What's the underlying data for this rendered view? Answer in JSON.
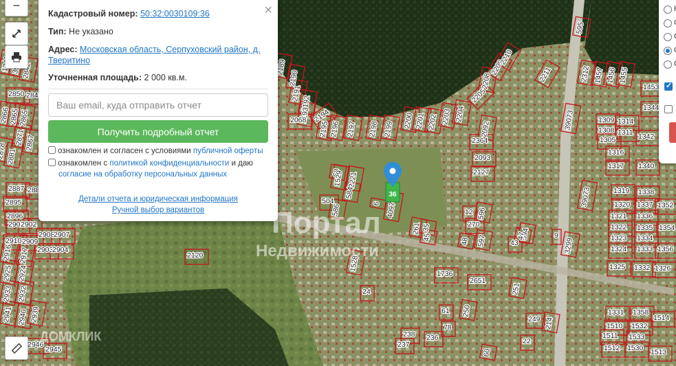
{
  "map": {
    "controls": {
      "zoom_out_label": "−",
      "fullscreen_icon": "expand-icon",
      "print_icon": "printer-icon",
      "ruler_icon": "ruler-icon"
    },
    "labels": [
      "2840",
      "2841",
      "2842",
      "2850",
      "2849",
      "2866",
      "2865",
      "2865",
      "2871",
      "2878",
      "2867",
      "2881",
      "2895",
      "2887",
      "2896",
      "2889",
      "2901",
      "2902",
      "2910",
      "2909",
      "2908",
      "2907",
      "2903",
      "2904",
      "2916",
      "2917",
      "2925",
      "2924",
      "2933",
      "2932",
      "2941",
      "2940",
      "2939",
      "2946",
      "2945",
      "2120",
      "2189",
      "2190",
      "2191",
      "2192",
      "2193",
      "2068",
      "2194",
      "2195",
      "2196",
      "2197",
      "2198",
      "2199",
      "2200",
      "2201",
      "2202",
      "2203",
      "2204",
      "2205",
      "2208",
      "2209",
      "2210",
      "2211",
      "2364",
      "2092",
      "2093",
      "2127",
      "2221",
      "68",
      "586",
      "584",
      "504",
      "6",
      "40976",
      "35",
      "261",
      "45",
      "12",
      "270",
      "596",
      "48",
      "597",
      "594",
      "43",
      "9",
      "3299",
      "39073",
      "39073",
      "1736",
      "2651",
      "251",
      "61",
      "250",
      "249",
      "22",
      "214",
      "238",
      "237",
      "236",
      "78",
      "60",
      "595",
      "2312",
      "1457",
      "1456",
      "1455",
      "1453",
      "1344",
      "1309",
      "1314",
      "1308",
      "1311",
      "1305",
      "1342",
      "1316",
      "1317",
      "1340",
      "1319",
      "1338",
      "1320",
      "1337",
      "1352",
      "1321",
      "1336",
      "1322",
      "1335",
      "1354",
      "1323",
      "1334",
      "1324",
      "1333",
      "1356",
      "1325",
      "1332",
      "1326",
      "1331",
      "1358",
      "1510",
      "1532",
      "1514",
      "1511",
      "1533",
      "1512",
      "1530",
      "1513",
      "1529",
      "1528",
      "24",
      "47",
      "13",
      "39"
    ],
    "watermark_main": "Портал",
    "watermark_sub": "Недвижимости",
    "watermark_bottom": "ДОМКЛИК",
    "marker_label": "36"
  },
  "popup": {
    "cadastral_label": "Кадастровый номер:",
    "cadastral_value": "50:32:0030109:36",
    "type_label": "Тип:",
    "type_value": "Не указано",
    "address_label": "Адрес:",
    "address_value": "Московская область, Серпуховский район, д. Тверитино",
    "area_label": "Уточненная площадь:",
    "area_value": "2 000 кв.м.",
    "close_label": "×",
    "email_placeholder": "Ваш email, куда отправить отчет",
    "submit_label": "Получить подробный отчет",
    "agree1_text": "ознакомлен и согласен с условиями",
    "agree1_link": "публичной оферты",
    "agree2_text": "ознакомлен с",
    "agree2_link": "политикой конфиденциальности",
    "agree2_mid": "и даю",
    "agree2_link2": "согласие на обработку персональных данных",
    "details_link": "Детали отчета и юридическая информация",
    "manual_link": "Ручной выбор вариантов"
  },
  "right_panel": {
    "radio_labels": [
      "К",
      "С",
      "С",
      "С",
      "С"
    ],
    "selected_index": 3
  }
}
